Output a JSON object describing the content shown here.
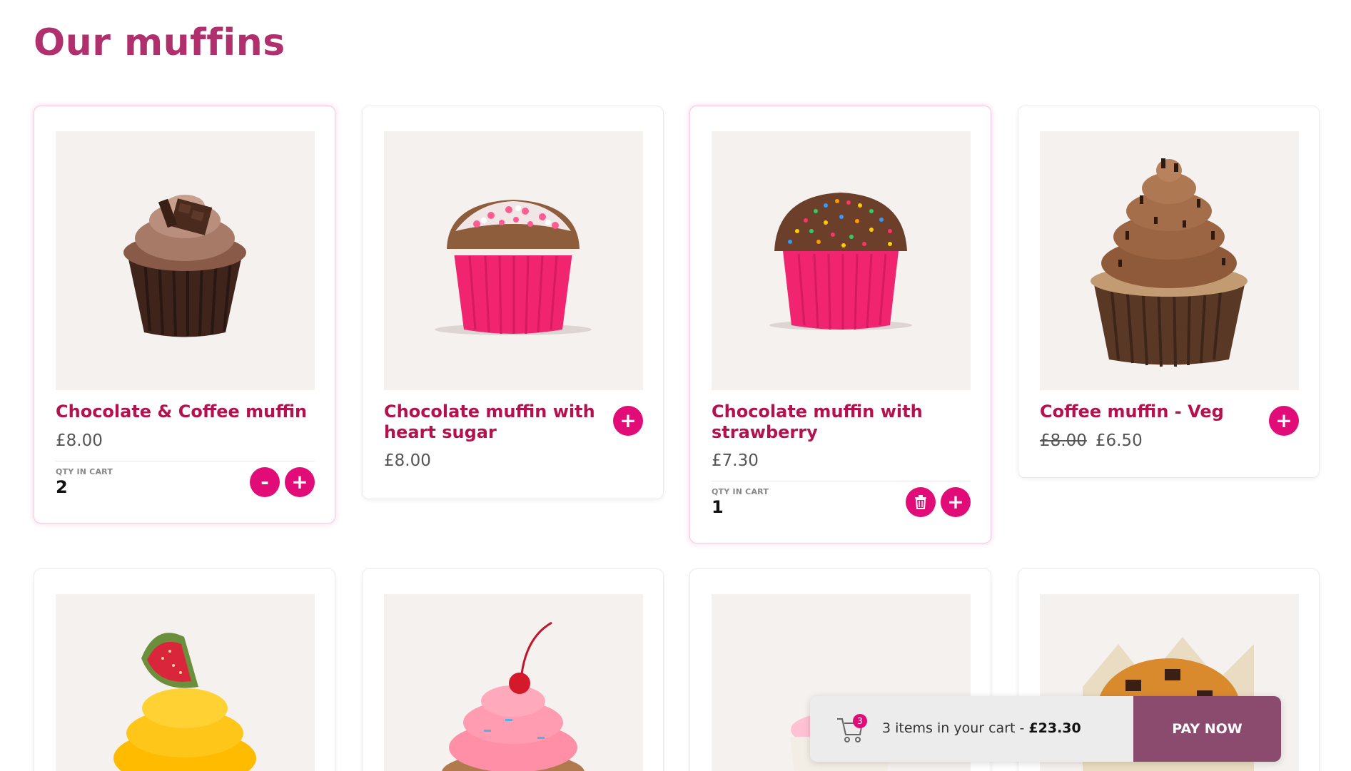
{
  "page": {
    "title": "Our muffins"
  },
  "products": [
    {
      "name": "Chocolate & Coffee muffin",
      "price": "£8.00",
      "old_price": "",
      "qty_label": "QTY IN CART",
      "qty": "2",
      "in_cart": true
    },
    {
      "name": "Chocolate muffin with heart sugar",
      "price": "£8.00",
      "old_price": "",
      "in_cart": false
    },
    {
      "name": "Chocolate muffin with strawberry",
      "price": "£7.30",
      "old_price": "",
      "qty_label": "QTY IN CART",
      "qty": "1",
      "in_cart": true
    },
    {
      "name": "Coffee muffin - Veg",
      "price": "£6.50",
      "old_price": "£8.00",
      "in_cart": false
    }
  ],
  "buttons": {
    "add": "+",
    "remove": "-"
  },
  "cart": {
    "badge": "3",
    "summary": "3 items in your cart - ",
    "total": "£23.30",
    "pay_label": "PAY NOW"
  },
  "icons": [
    "cart-icon",
    "trash-icon",
    "plus-icon",
    "minus-icon"
  ],
  "colors": {
    "accent": "#e20c79",
    "title": "#b0306e",
    "product_name": "#b3124f",
    "pay_button": "#8a4b6f"
  }
}
